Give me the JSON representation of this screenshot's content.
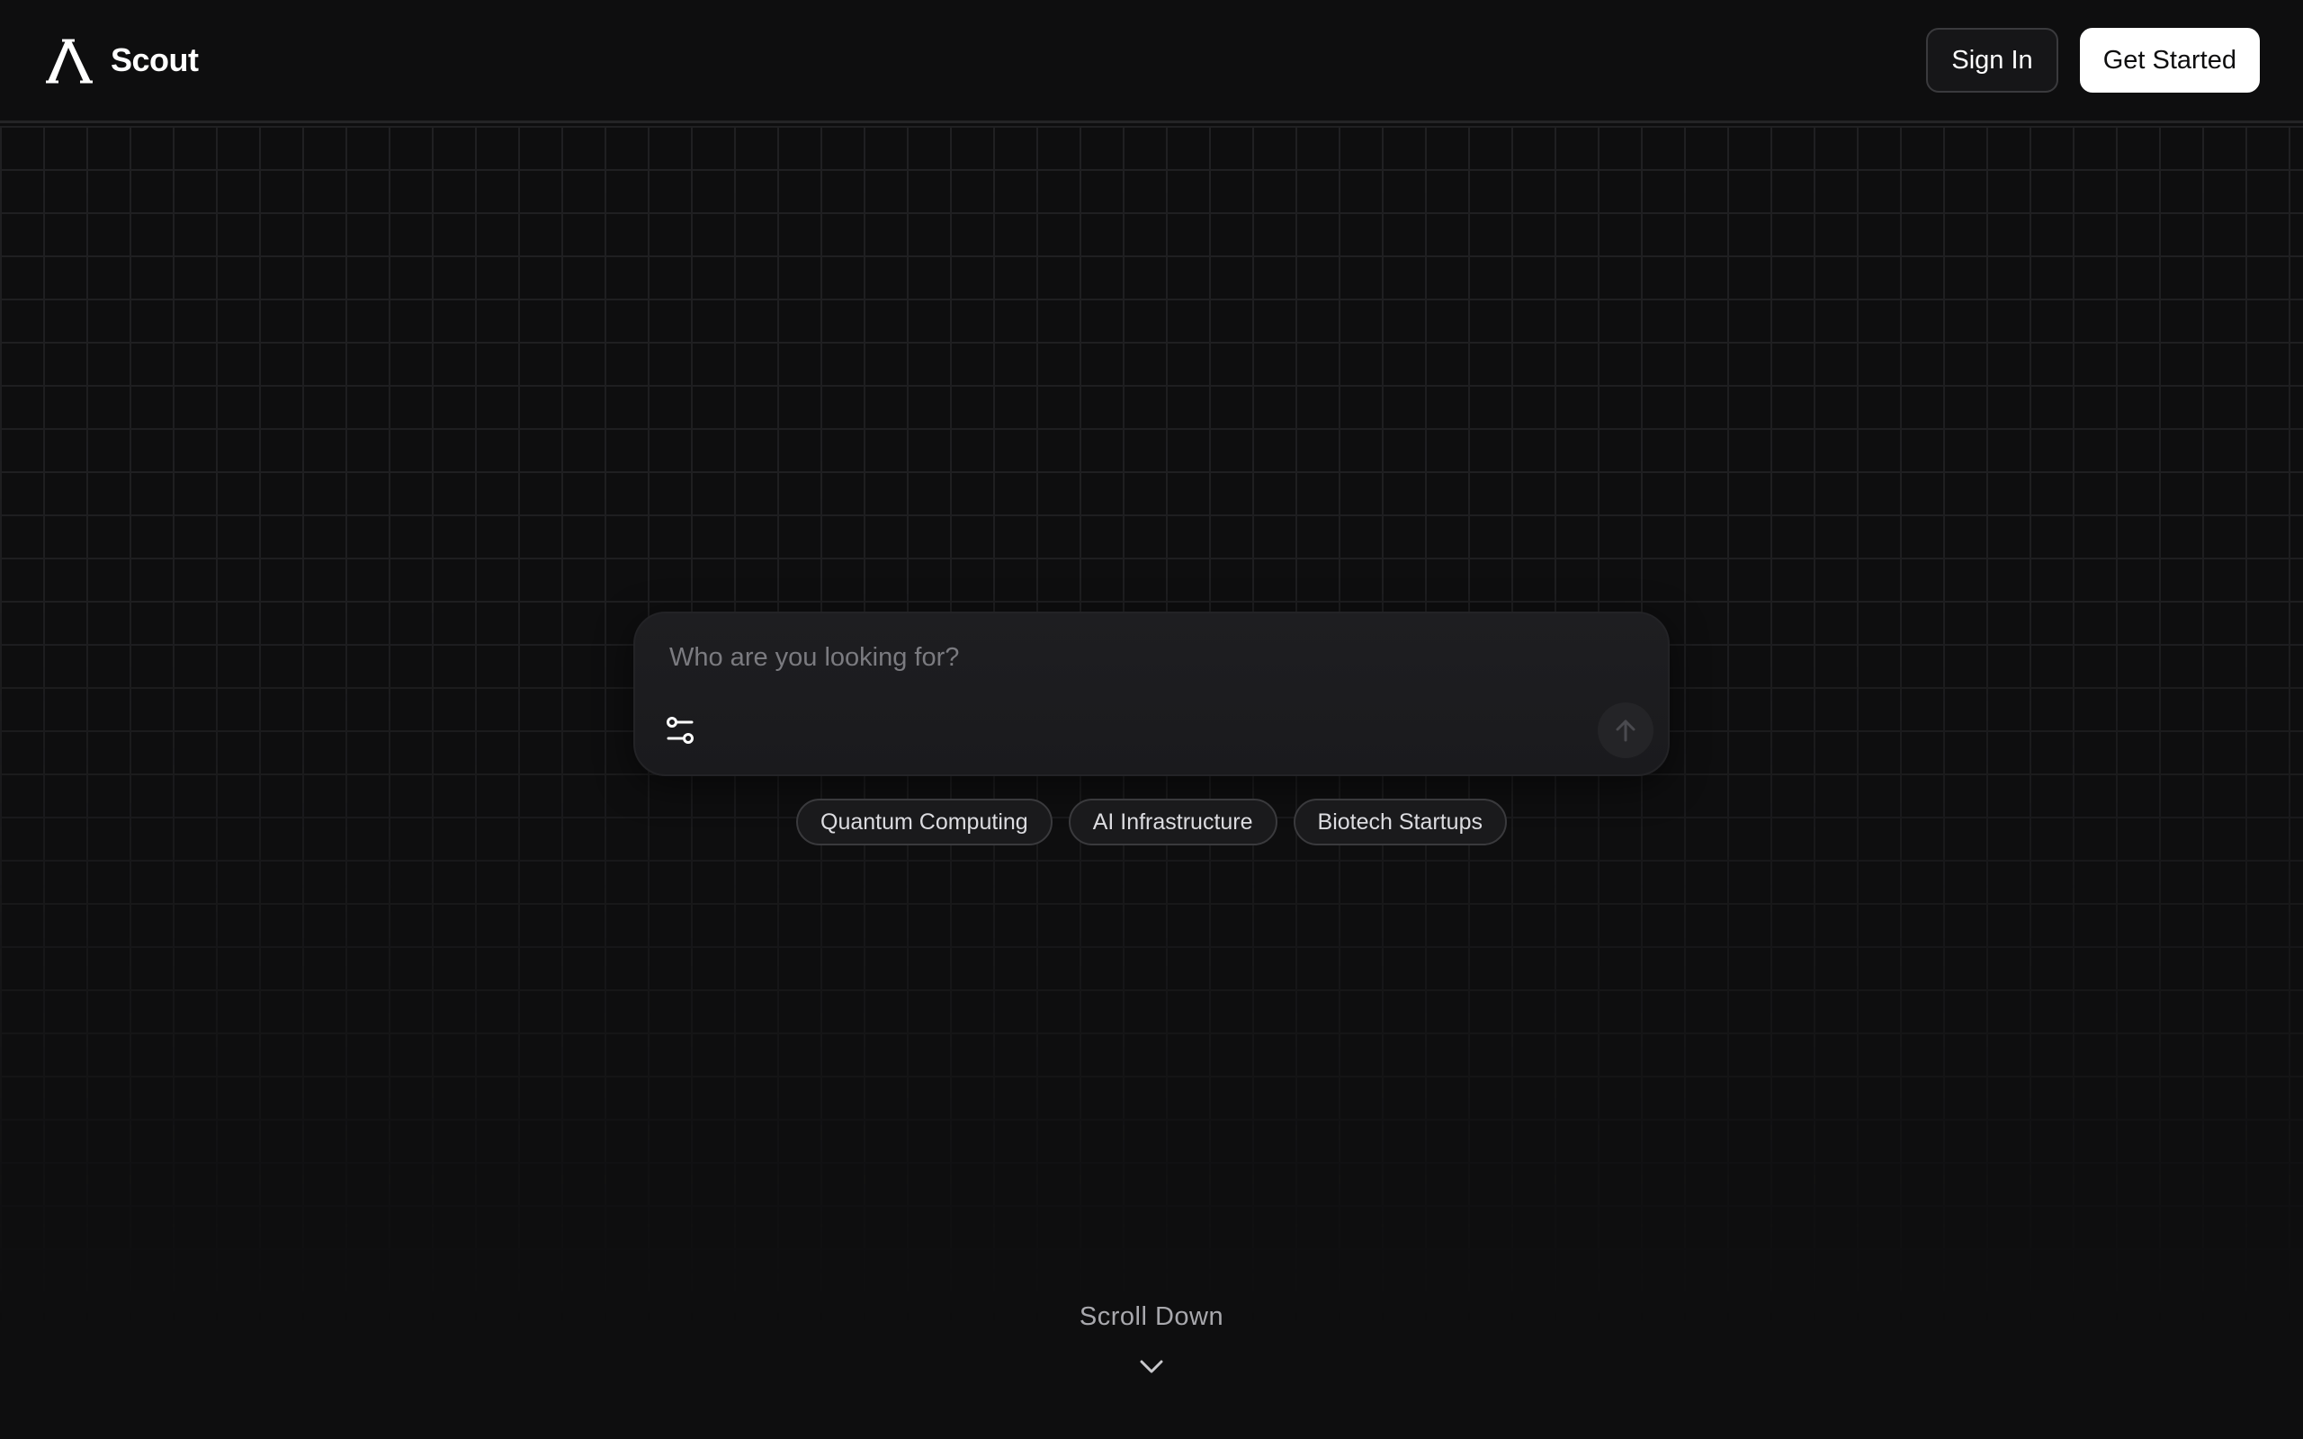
{
  "header": {
    "brand_name": "Scout",
    "sign_in_label": "Sign In",
    "get_started_label": "Get Started"
  },
  "search": {
    "placeholder": "Who are you looking for?",
    "value": ""
  },
  "suggestions": [
    {
      "label": "Quantum Computing"
    },
    {
      "label": "AI Infrastructure"
    },
    {
      "label": "Biotech Startups"
    }
  ],
  "scroll_cue": {
    "label": "Scroll Down"
  },
  "icons": {
    "logo": "lambda-logo-icon",
    "filter": "sliders-icon",
    "send": "arrow-up-icon",
    "scroll": "chevron-down-icon"
  },
  "colors": {
    "background": "#0e0e0f",
    "grid_line": "#202022",
    "search_surface": "#1e1e21",
    "primary_button_bg": "#ffffff",
    "muted_text": "#7b7b80"
  }
}
